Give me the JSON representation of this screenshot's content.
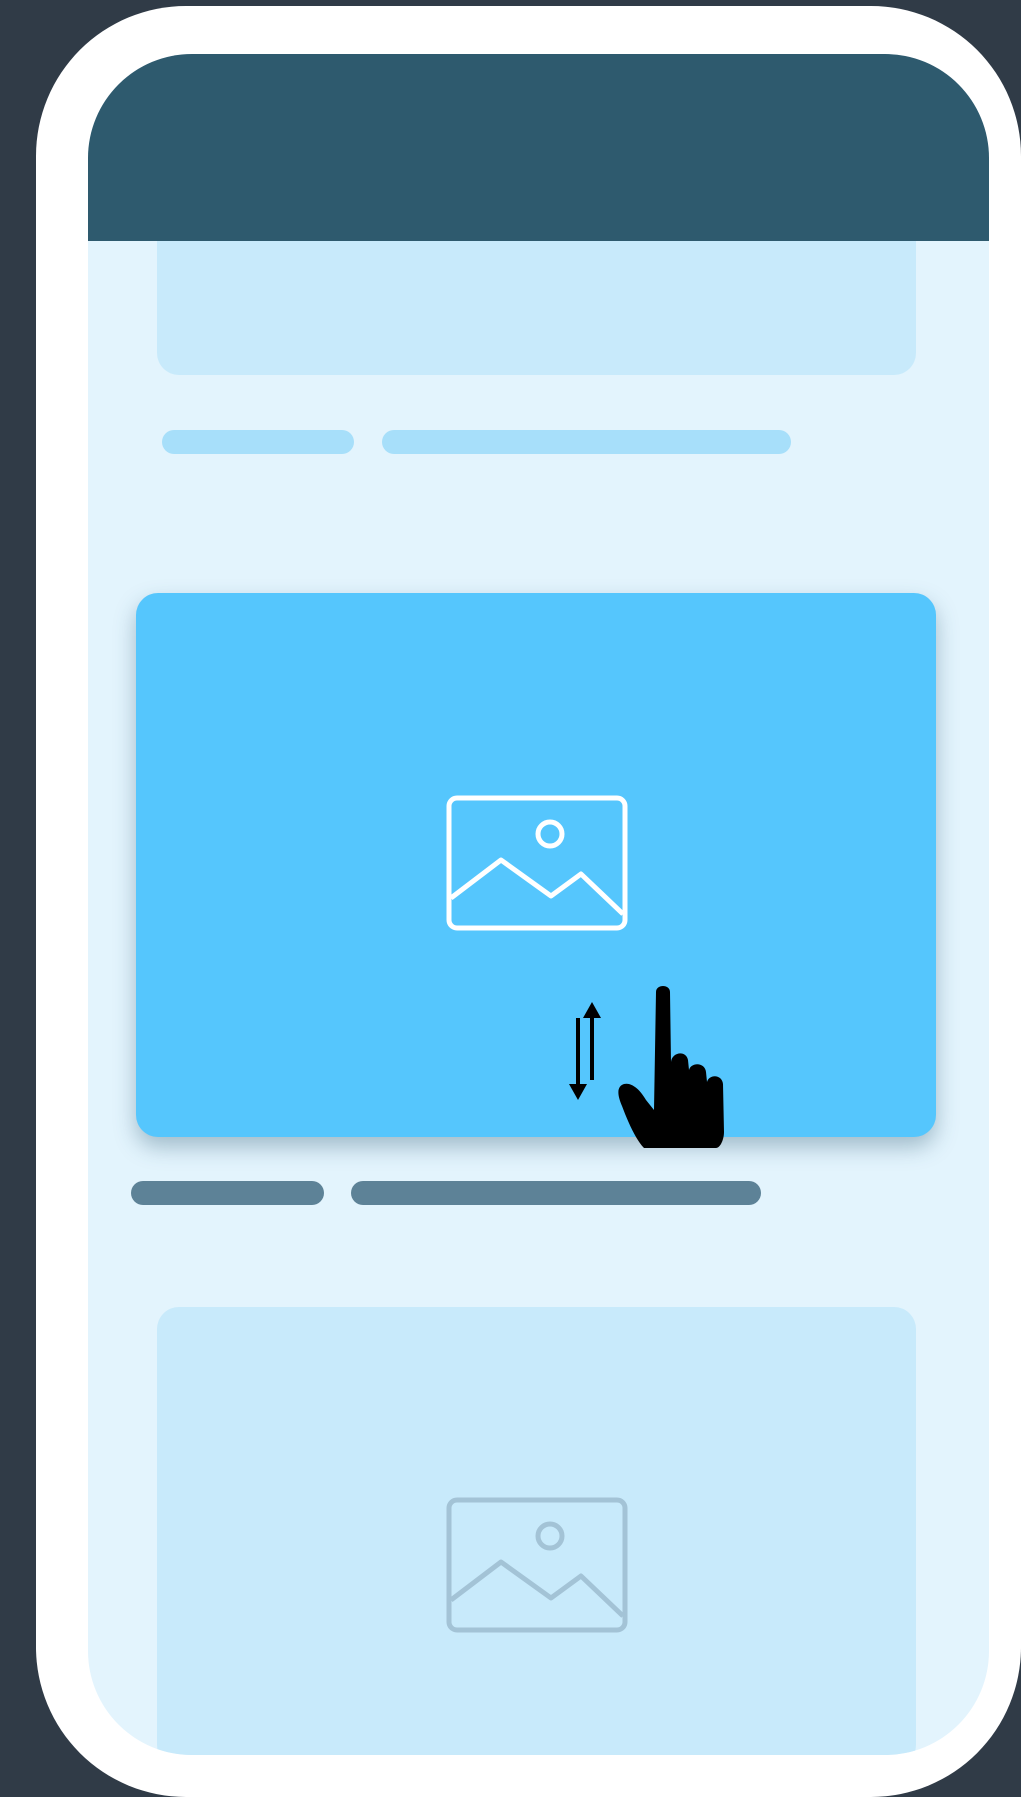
{
  "colors": {
    "background": "#303b47",
    "phone_frame": "#ffffff",
    "screen": "#e3f4fd",
    "header": "#2e5a6e",
    "card_muted": "#c8eafb",
    "card_active": "#55c6fd",
    "text_placeholder_light": "#a7dffa",
    "text_placeholder_dark": "#5d8297",
    "icon_on_active": "#ffffff",
    "icon_faded": "#a3c3d6",
    "pointer": "#000000"
  },
  "icons": {
    "active_card_image": "image-placeholder-icon",
    "faded_card_image": "image-placeholder-icon",
    "gesture_arrows": "up-down-arrows-icon",
    "gesture_hand": "hand-pointer-icon"
  }
}
